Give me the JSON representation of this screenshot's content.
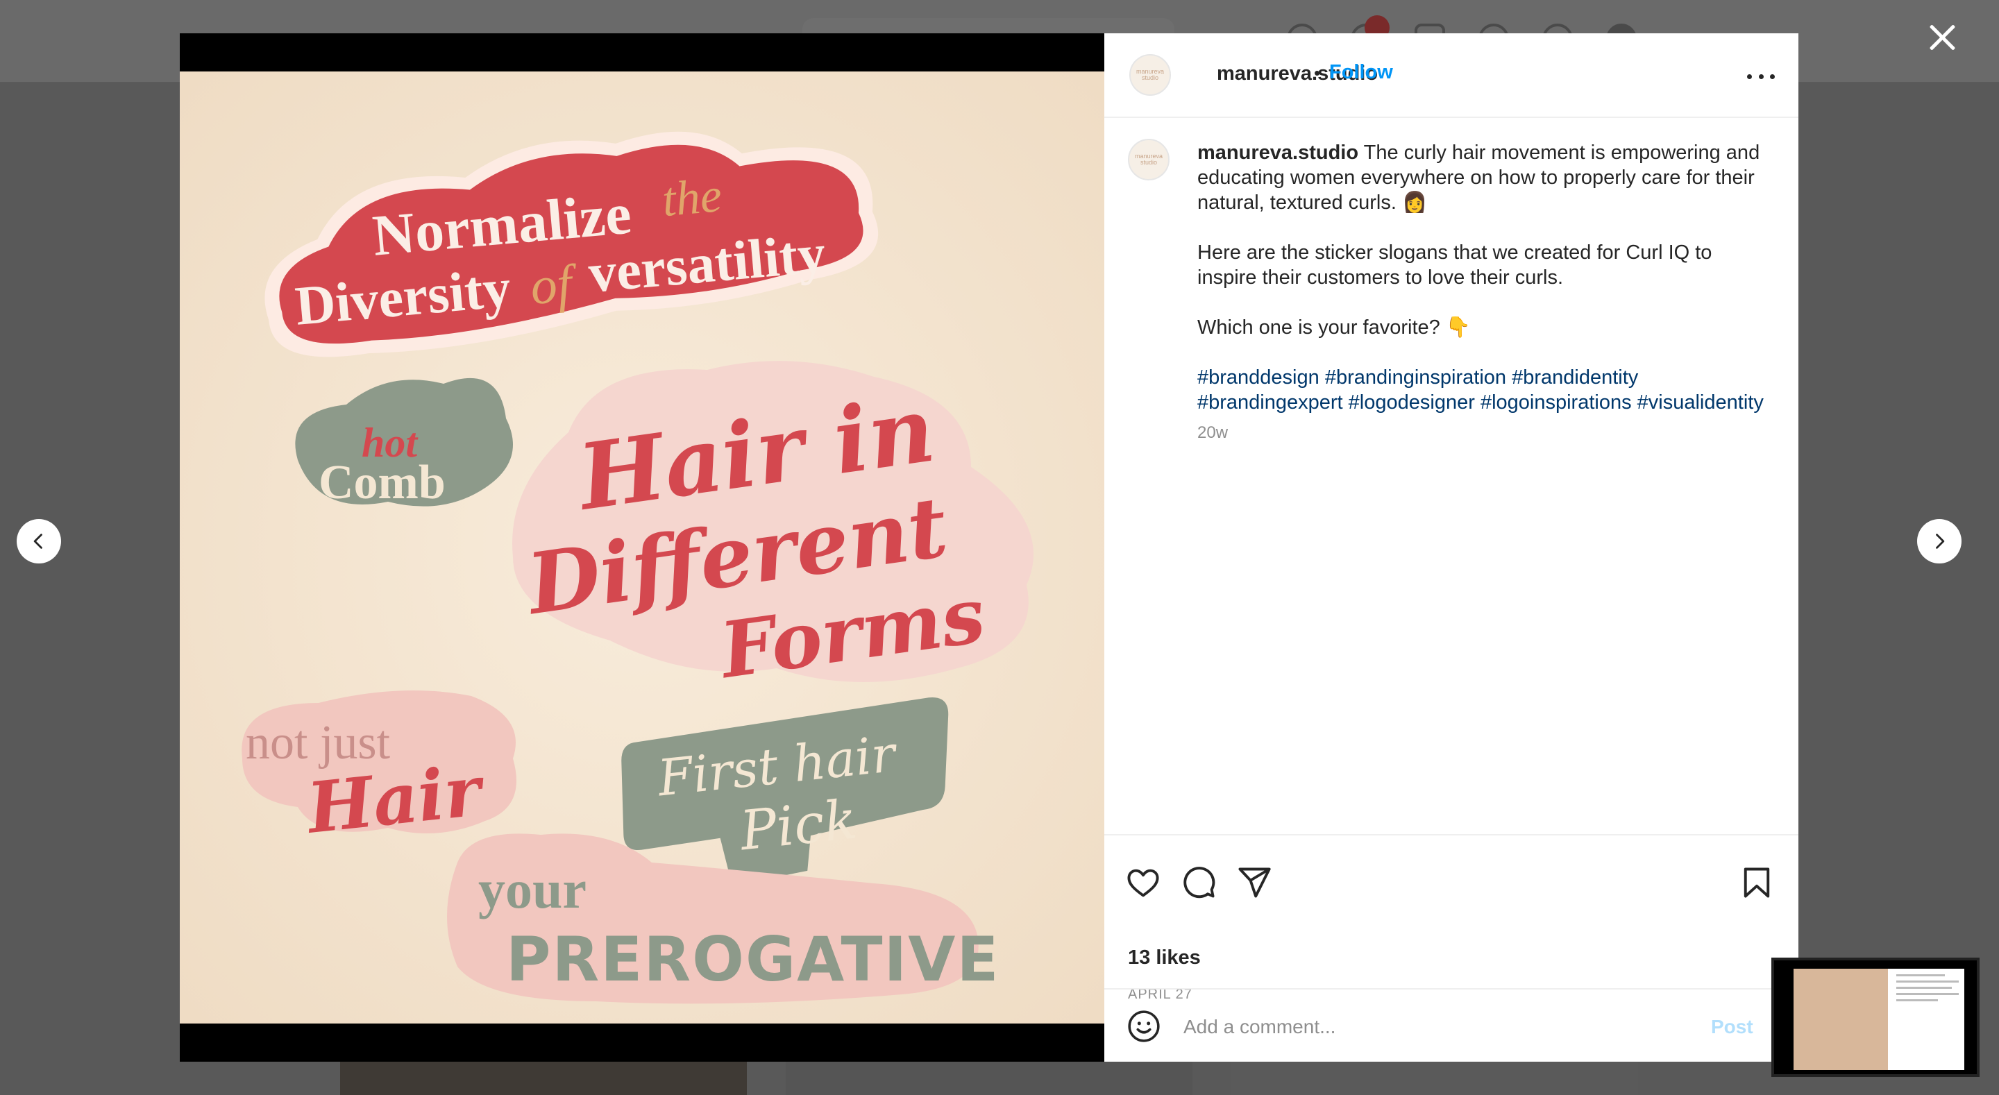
{
  "post": {
    "username": "manureva.studio",
    "follow_label": "Follow",
    "separator": "•",
    "avatar_text": "manureva studio",
    "caption_lines": [
      "The curly hair movement is empowering and educating women everywhere on how to properly care for their natural, textured curls. 👩",
      "Here are the sticker slogans that we created for Curl IQ to inspire their customers to love their curls.",
      "Which one is your favorite? 👇"
    ],
    "hashtags": [
      "#branddesign",
      "#brandinginspiration",
      "#brandidentity",
      "#brandingexpert",
      "#logodesigner",
      "#logoinspirations",
      "#visualidentity"
    ],
    "time_ago": "20w",
    "likes": "13 likes",
    "date": "APRIL 27",
    "comment_placeholder": "Add a comment...",
    "post_label": "Post"
  },
  "stickers": {
    "s1_line1": "Normalize",
    "s1_the": "the",
    "s1_line2": "Diversity",
    "s1_of": "of",
    "s1_line3": "versatility",
    "s2_line1": "hot",
    "s2_line2": "Comb",
    "s3_line1": "Hair in",
    "s3_line2": "Different",
    "s3_line3": "Forms",
    "s4_line1": "not just",
    "s4_line2": "Hair",
    "s5_line1": "First hair",
    "s5_line2": "Pick",
    "s6_line1": "your",
    "s6_line2": "PREROGATIVE"
  },
  "colors": {
    "accent_blue": "#0095f6",
    "hashtag_blue": "#00376b",
    "sticker_red": "#d4484f",
    "sticker_sage": "#8d9a8a",
    "sticker_pink": "#f2c7bf",
    "cream": "#f4e7d3"
  }
}
